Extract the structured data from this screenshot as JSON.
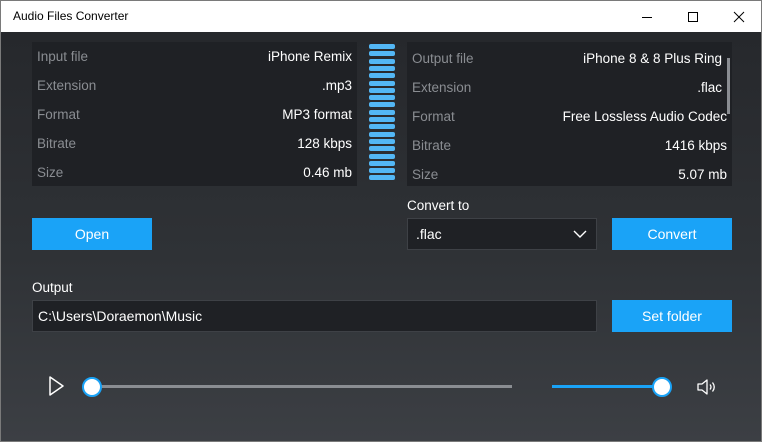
{
  "window": {
    "title": "Audio Files Converter"
  },
  "input_panel": {
    "rows": [
      {
        "label": "Input file",
        "value": "iPhone Remix"
      },
      {
        "label": "Extension",
        "value": ".mp3"
      },
      {
        "label": "Format",
        "value": "MP3 format"
      },
      {
        "label": "Bitrate",
        "value": "128 kbps"
      },
      {
        "label": "Size",
        "value": "0.46 mb"
      }
    ]
  },
  "output_panel": {
    "rows": [
      {
        "label": "Output file",
        "value": "iPhone 8 & 8 Plus Ring"
      },
      {
        "label": "Extension",
        "value": ".flac"
      },
      {
        "label": "Format",
        "value": "Free Lossless Audio Codec"
      },
      {
        "label": "Bitrate",
        "value": "1416 kbps"
      },
      {
        "label": "Size",
        "value": "5.07 mb"
      }
    ]
  },
  "controls": {
    "open_label": "Open",
    "convert_to_label": "Convert to",
    "convert_to_value": ".flac",
    "convert_label": "Convert",
    "output_label": "Output",
    "output_path": "C:\\Users\\Doraemon\\Music",
    "set_folder_label": "Set folder"
  },
  "player": {
    "progress": 0.0,
    "volume": 1.0
  },
  "colors": {
    "accent": "#1aa3f7",
    "meter": "#53b7f5",
    "panel_bg": "#1f2125",
    "label_gray": "#8a8d92"
  },
  "icons": {
    "play": "play-icon",
    "volume": "volume-icon",
    "dropdown": "chevron-down-icon"
  }
}
